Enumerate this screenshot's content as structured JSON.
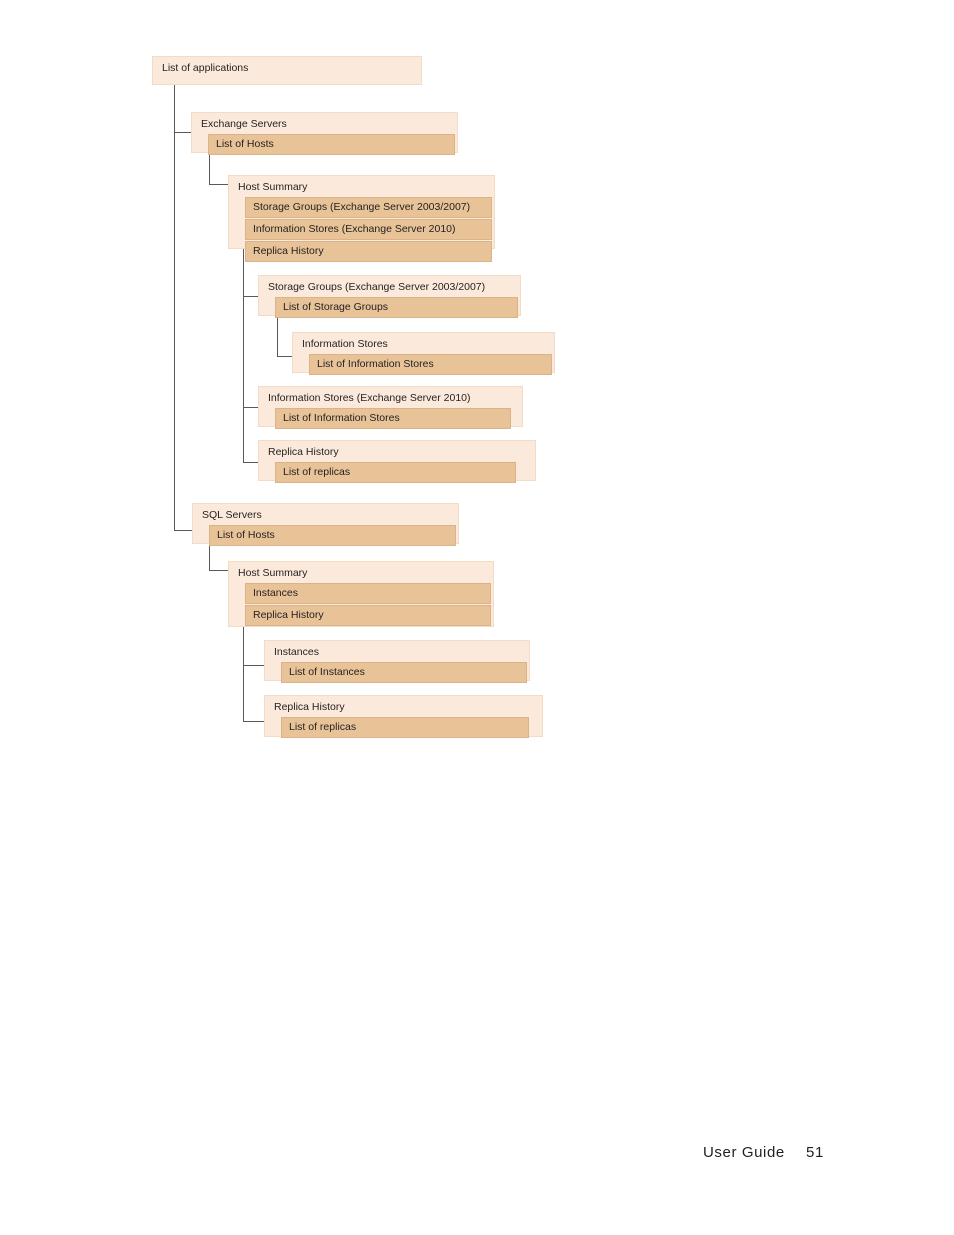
{
  "page": {
    "footer_label": "User Guide",
    "footer_page": "51"
  },
  "colors": {
    "box_fill": "#fbeadb",
    "box_border": "#f3dcc6",
    "item_fill": "#e8c398",
    "item_border": "#dcb288",
    "connector": "#58595b",
    "text": "#231f20",
    "background": "#ffffff"
  },
  "diagram": {
    "type": "hierarchy-tree",
    "title": "Application navigation hierarchy",
    "nodes": [
      {
        "id": "root",
        "title": "List of applications",
        "items": []
      },
      {
        "id": "exchange-servers",
        "title": "Exchange Servers",
        "items": [
          "List of Hosts"
        ]
      },
      {
        "id": "exchange-host-summary",
        "title": "Host Summary",
        "items": [
          "Storage Groups (Exchange Server 2003/2007)",
          "Information Stores (Exchange Server 2010)",
          "Replica History"
        ]
      },
      {
        "id": "storage-groups",
        "title": "Storage Groups (Exchange Server 2003/2007)",
        "items": [
          "List of Storage Groups"
        ]
      },
      {
        "id": "information-stores-nested",
        "title": "Information Stores",
        "items": [
          "List of Information Stores"
        ]
      },
      {
        "id": "information-stores-2010",
        "title": "Information Stores (Exchange Server 2010)",
        "items": [
          "List of Information Stores"
        ]
      },
      {
        "id": "exchange-replica-history",
        "title": "Replica History",
        "items": [
          "List of replicas"
        ]
      },
      {
        "id": "sql-servers",
        "title": "SQL Servers",
        "items": [
          "List of Hosts"
        ]
      },
      {
        "id": "sql-host-summary",
        "title": "Host Summary",
        "items": [
          "Instances",
          "Replica History"
        ]
      },
      {
        "id": "sql-instances",
        "title": "Instances",
        "items": [
          "List of Instances"
        ]
      },
      {
        "id": "sql-replica-history",
        "title": "Replica History",
        "items": [
          "List of replicas"
        ]
      }
    ]
  }
}
